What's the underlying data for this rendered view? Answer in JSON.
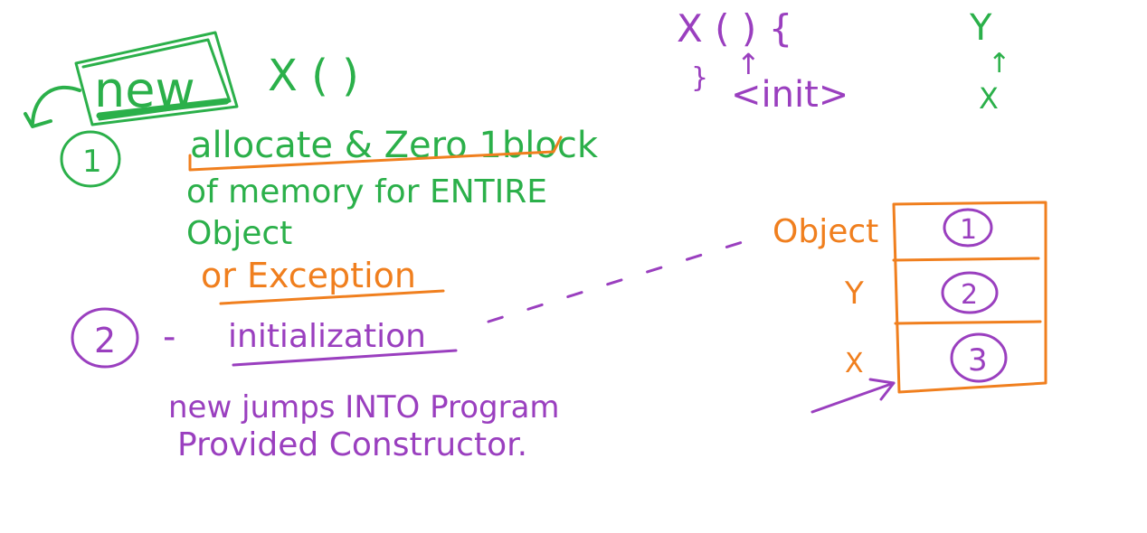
{
  "colors": {
    "green": "#2bb04a",
    "purple": "#9a3fbf",
    "orange": "#f07f1e",
    "background": "#ffffff"
  },
  "step1": {
    "keyword": "new",
    "call": "X ( )",
    "number": "1",
    "line1": "allocate & Zero 1block",
    "line2": "of memory for ENTIRE",
    "line3": "Object",
    "alt": "or Exception"
  },
  "step2": {
    "number": "2",
    "dash": "-",
    "label": "initialization",
    "line1": "new jumps INTO Program",
    "line2": "Provided Constructor."
  },
  "constructor_sig": {
    "line1": "X ( ) {",
    "brace": "}",
    "arrow": "↑",
    "init": "<init>"
  },
  "hierarchy": {
    "top": "Y",
    "arrow": "↑",
    "bottom": "X"
  },
  "object_box": {
    "label": "Object",
    "row_labels": [
      "Y",
      "X"
    ],
    "cells": [
      "1",
      "2",
      "3"
    ]
  }
}
